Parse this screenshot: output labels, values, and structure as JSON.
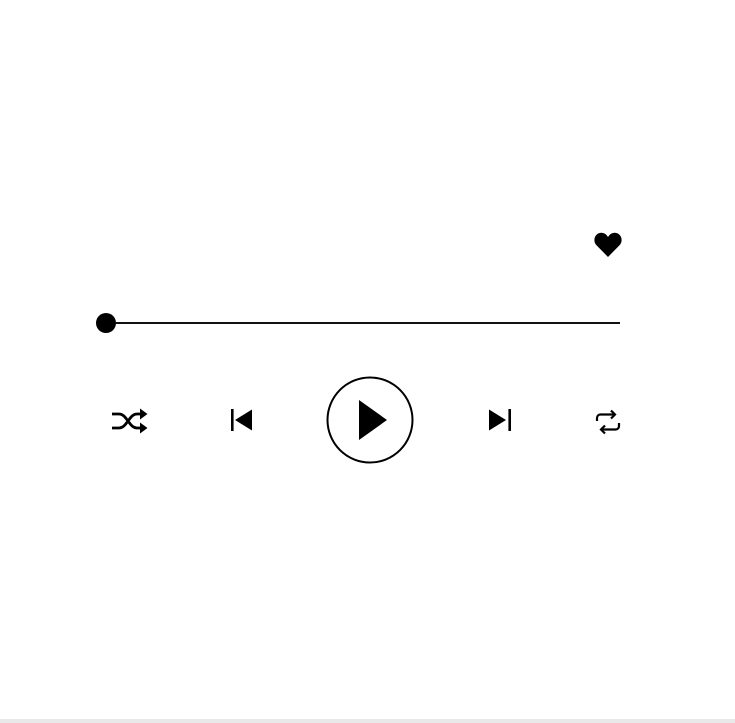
{
  "player": {
    "progress": 0.0,
    "liked": true,
    "controls": {
      "favorite_icon": "heart-icon",
      "shuffle_icon": "shuffle-icon",
      "previous_icon": "skip-previous-icon",
      "play_icon": "play-icon",
      "next_icon": "skip-next-icon",
      "repeat_icon": "repeat-icon"
    }
  },
  "colors": {
    "foreground": "#000000",
    "background": "#ffffff"
  }
}
